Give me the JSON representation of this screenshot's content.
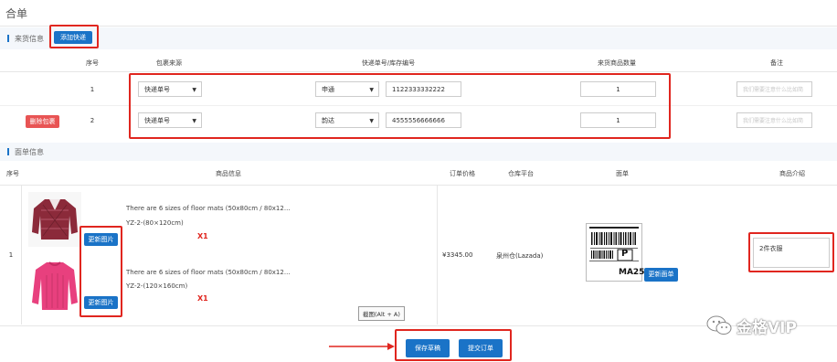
{
  "page": {
    "title": "合单"
  },
  "incoming": {
    "section_label": "来货信息",
    "add_express_label": "添加快递",
    "columns": [
      "序号",
      "包裹来源",
      "快递单号/库存编号",
      "来货商品数量",
      "备注"
    ],
    "rows": [
      {
        "index": "1",
        "source": "快递单号",
        "carrier": "申通",
        "tracking": "1122333332222",
        "qty": "1",
        "remark_placeholder": "我们需要注意什么比如简",
        "delete_label": ""
      },
      {
        "index": "2",
        "source": "快递单号",
        "carrier": "韵达",
        "tracking": "4555556666666",
        "qty": "1",
        "remark_placeholder": "我们需要注意什么比如简",
        "delete_label": "删除包裹"
      }
    ]
  },
  "face_sheet": {
    "section_label": "面单信息",
    "columns": [
      "序号",
      "商品信息",
      "订单价格",
      "仓库平台",
      "面单",
      "商品介绍"
    ],
    "row": {
      "index": "1",
      "products": [
        {
          "title": "There are 6 sizes of floor mats (50x80cm / 80x12...",
          "sku": "YZ-2-(80×120cm)",
          "qty": "X1",
          "update_image_label": "更新图片"
        },
        {
          "title": "There are 6 sizes of floor mats (50x80cm / 80x12...",
          "sku": "YZ-2-(120×160cm)",
          "qty": "X1",
          "update_image_label": "更新图片"
        }
      ],
      "price": "¥3345.00",
      "warehouse": "泉州仓(Lazada)",
      "label_code": "MA25",
      "label_letter": "P",
      "update_label_button": "更新面单",
      "intro": "2件衣服"
    },
    "tooltip": "截图(Alt + A)"
  },
  "actions": {
    "save_draft": "保存草稿",
    "submit": "提交订单"
  },
  "watermark": {
    "text": "金格VIP"
  },
  "colors": {
    "accent": "#1a73c7",
    "danger": "#e85454",
    "highlight": "#e0261f"
  }
}
